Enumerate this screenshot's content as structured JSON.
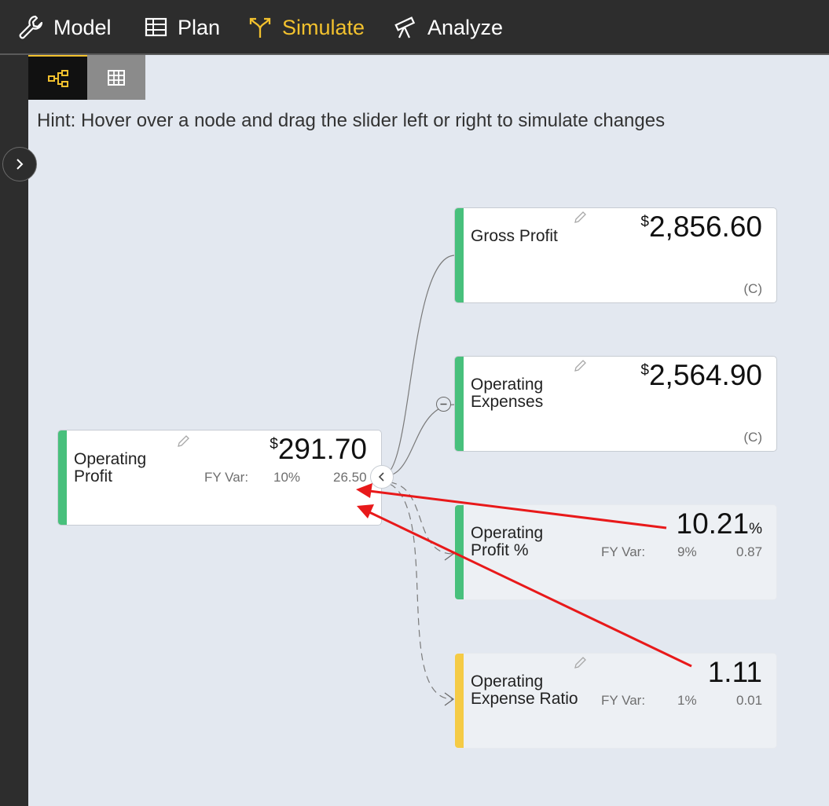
{
  "nav": {
    "model": "Model",
    "plan": "Plan",
    "simulate": "Simulate",
    "analyze": "Analyze"
  },
  "icons": {
    "model": "wrench-icon",
    "plan": "table-icon",
    "simulate": "split-arrows-icon",
    "analyze": "telescope-icon",
    "view_tree": "hierarchy-icon",
    "view_grid": "grid-icon",
    "expander": "chevron-right-icon",
    "collapse": "chevron-left-icon",
    "edit": "pencil-icon"
  },
  "hint": "Hint: Hover over a node and drag the slider left or right to simulate changes",
  "colors": {
    "accent_active": "#f2c12e",
    "green": "#48c07c",
    "yellow": "#f5cb45",
    "arrow_red": "#e8191a"
  },
  "nodes": {
    "operating_profit": {
      "title_line1": "Operating",
      "title_line2": "Profit",
      "currency": "$",
      "value": "291.70",
      "fy_var_label": "FY Var:",
      "fy_var_pct": "10%",
      "fy_var_abs": "26.50"
    },
    "gross_profit": {
      "title": "Gross Profit",
      "currency": "$",
      "value": "2,856.60",
      "tag": "(C)"
    },
    "operating_expenses": {
      "title_line1": "Operating",
      "title_line2": "Expenses",
      "currency": "$",
      "value": "2,564.90",
      "tag": "(C)"
    },
    "operating_profit_pct": {
      "title_line1": "Operating",
      "title_line2": "Profit %",
      "value": "10.21",
      "unit": "%",
      "fy_var_label": "FY Var:",
      "fy_var_pct": "9%",
      "fy_var_abs": "0.87"
    },
    "operating_expense_ratio": {
      "title_line1": "Operating",
      "title_line2": "Expense Ratio",
      "value": "1.11",
      "fy_var_label": "FY Var:",
      "fy_var_pct": "1%",
      "fy_var_abs": "0.01"
    }
  }
}
